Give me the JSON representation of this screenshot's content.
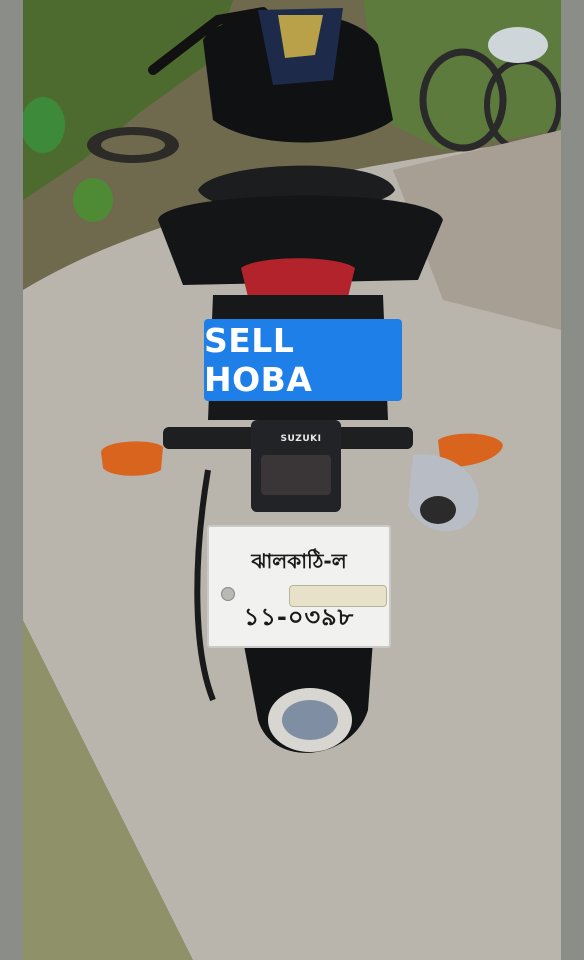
{
  "overlay": {
    "banner_text": "SELL HOBA"
  },
  "motorcycle": {
    "brand_badge": "SUZUKI",
    "license_plate": {
      "line1": "ঝালকাঠি-ল",
      "line2": "১১-০৩৯৮"
    }
  },
  "colors": {
    "banner_bg": "#1f7fe8",
    "banner_text": "#ffffff",
    "body": "#121314",
    "tail_light": "#c02a2a",
    "indicator": "#e2651b"
  }
}
